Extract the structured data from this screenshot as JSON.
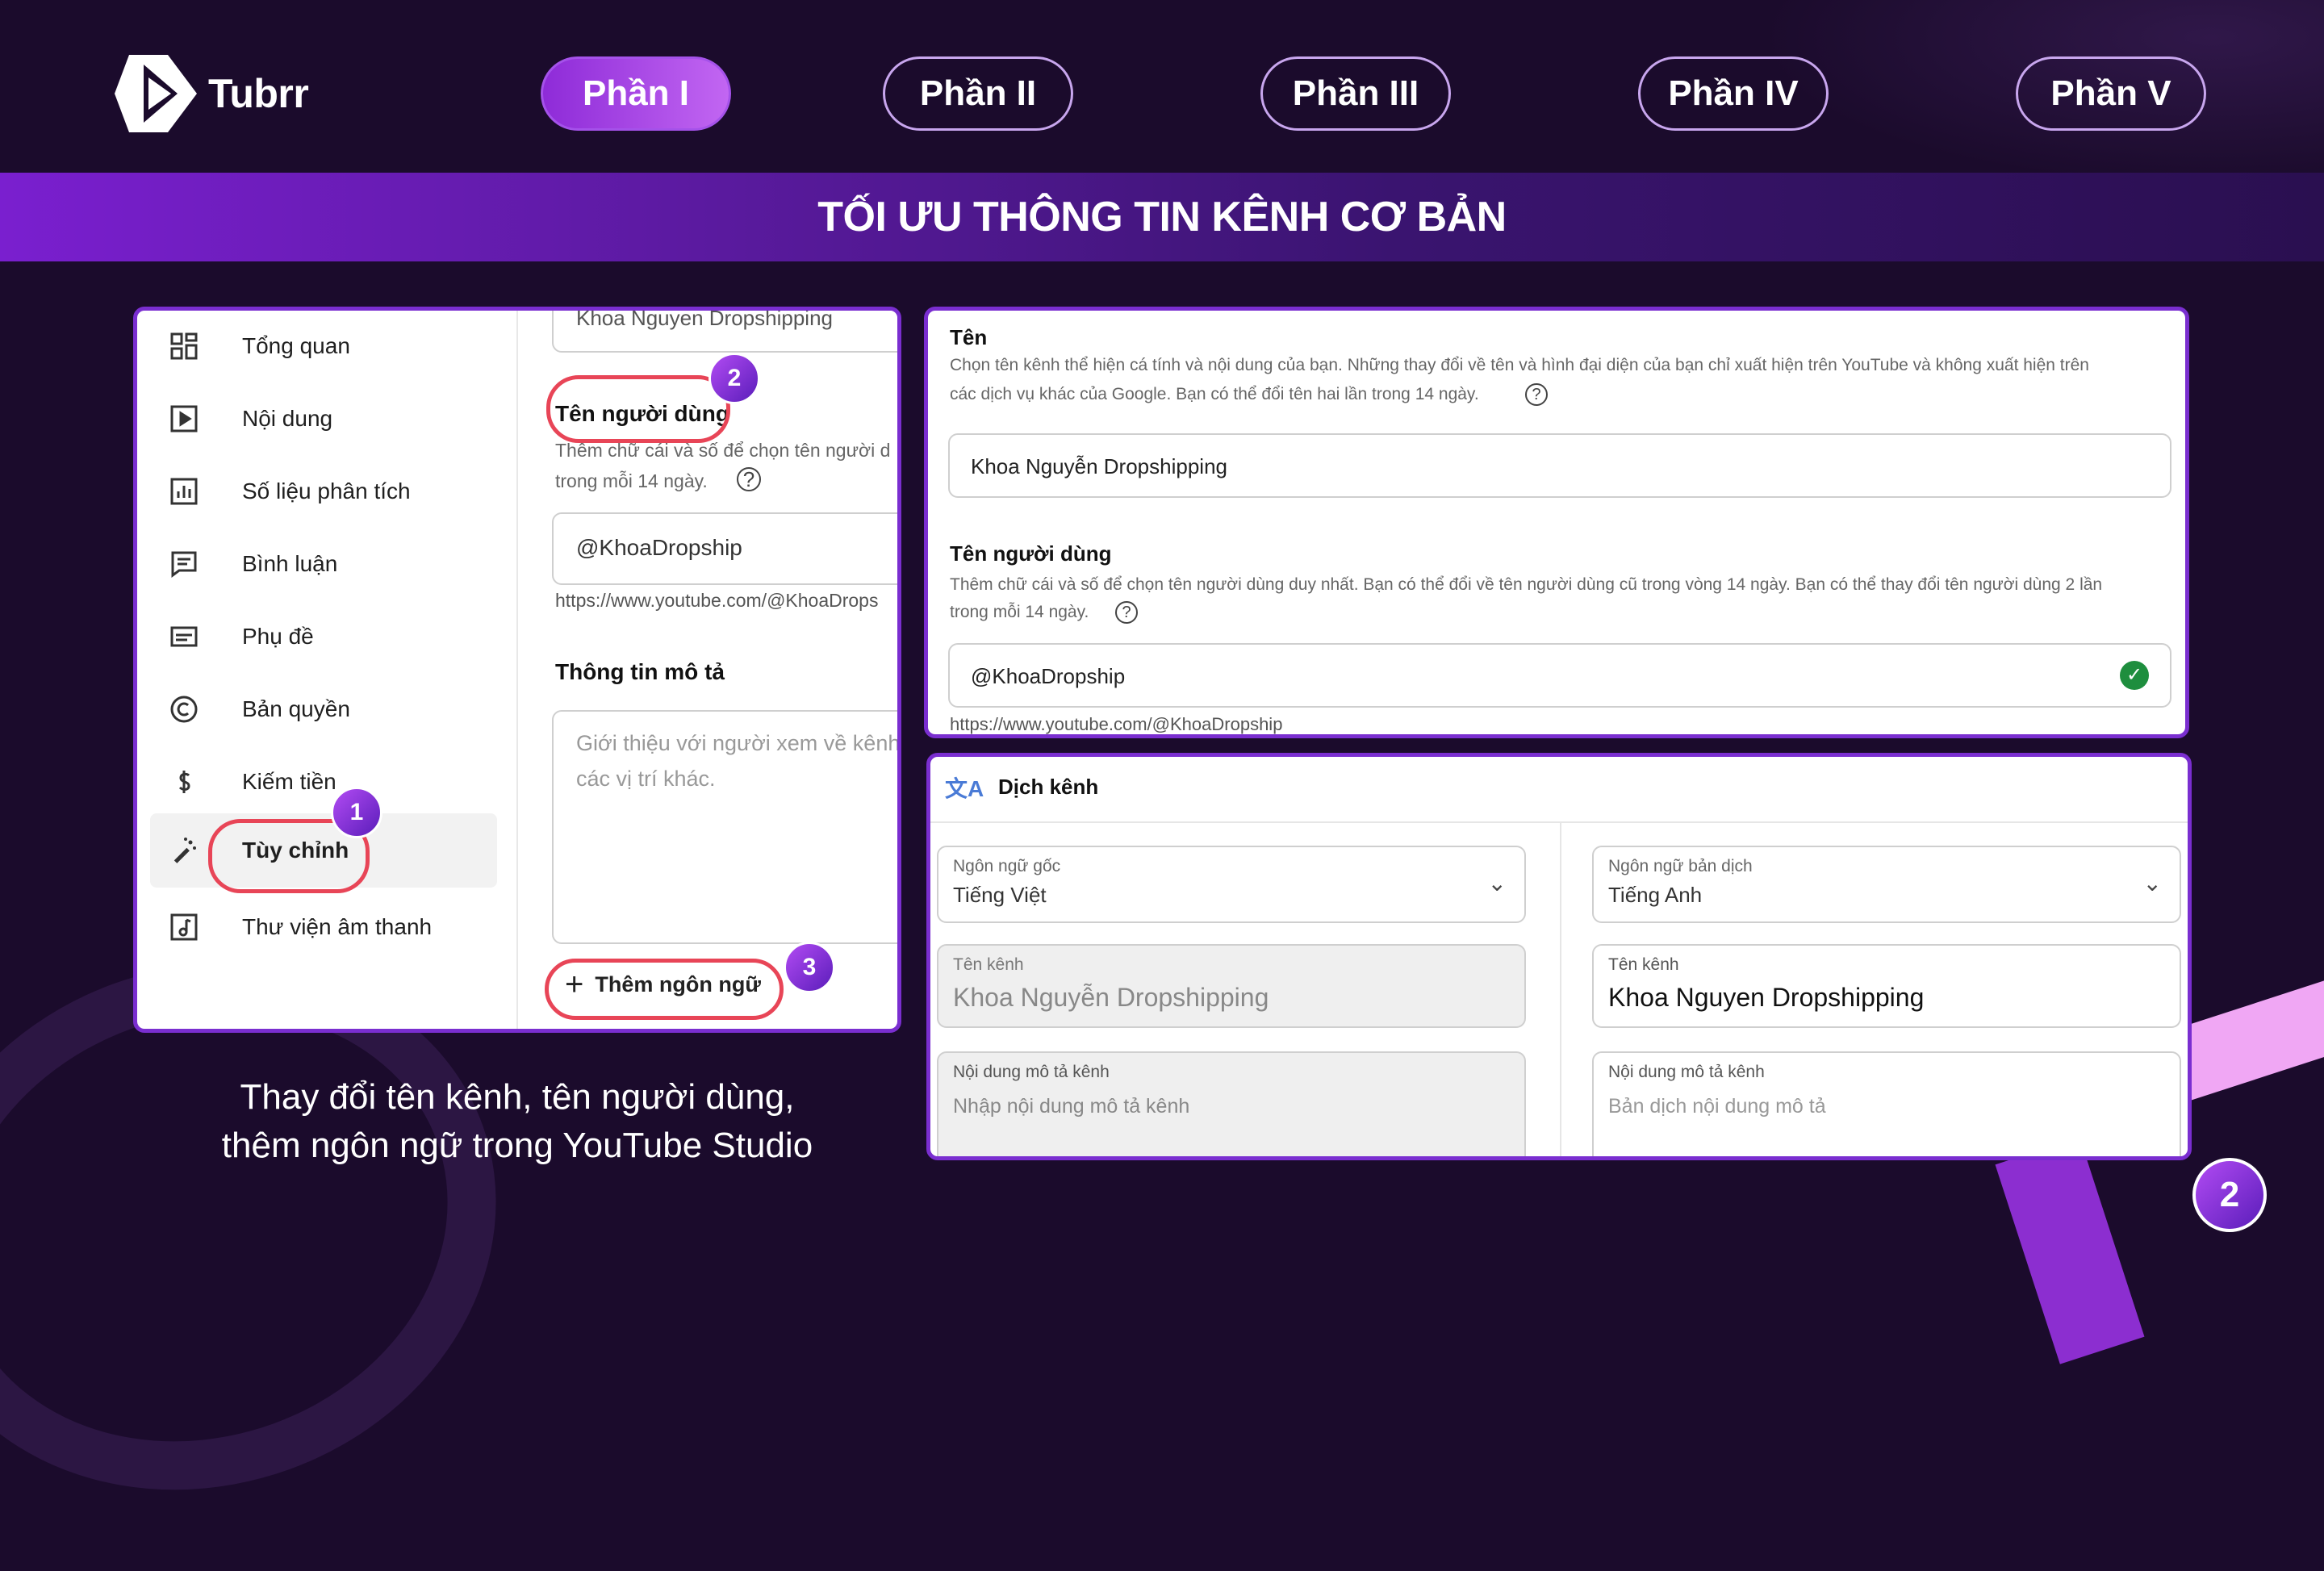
{
  "brand": {
    "name": "Tubrr"
  },
  "tabs": [
    {
      "label": "Phần I",
      "active": true
    },
    {
      "label": "Phần II",
      "active": false
    },
    {
      "label": "Phần III",
      "active": false
    },
    {
      "label": "Phần IV",
      "active": false
    },
    {
      "label": "Phần V",
      "active": false
    }
  ],
  "section_title": "TỐI ƯU THÔNG TIN KÊNH CƠ BẢN",
  "left_screenshot": {
    "nav": [
      {
        "label": "Tổng quan",
        "icon": "dashboard-icon"
      },
      {
        "label": "Nội dung",
        "icon": "content-icon"
      },
      {
        "label": "Số liệu phân tích",
        "icon": "analytics-icon"
      },
      {
        "label": "Bình luận",
        "icon": "comments-icon"
      },
      {
        "label": "Phụ đề",
        "icon": "subtitles-icon"
      },
      {
        "label": "Bản quyền",
        "icon": "copyright-icon"
      },
      {
        "label": "Kiếm tiền",
        "icon": "dollar-icon"
      },
      {
        "label": "Tùy chỉnh",
        "icon": "magic-wand-icon",
        "active": true
      },
      {
        "label": "Thư viện âm thanh",
        "icon": "audio-library-icon"
      }
    ],
    "channel_name_value": "Khoa Nguyen Dropshipping",
    "handle_label": "Tên người dùng",
    "handle_help": "Thêm chữ cái và số để chọn tên người d",
    "handle_help_2": "trong mỗi 14 ngày.",
    "handle_value": "@KhoaDropship",
    "handle_url": "https://www.youtube.com/@KhoaDrops",
    "description_label": "Thông tin mô tả",
    "description_placeholder_1": "Giới thiệu với người xem về kênh",
    "description_placeholder_2": "các vị trí khác.",
    "add_language_label": "Thêm ngôn ngữ",
    "badges": [
      "1",
      "2",
      "3"
    ]
  },
  "right_top": {
    "name_label": "Tên",
    "name_help_1": "Chọn tên kênh thể hiện cá tính và nội dung của bạn. Những thay đổi về tên và hình đại diện của bạn chỉ xuất hiện trên YouTube và không xuất hiện trên",
    "name_help_2": "các dịch vụ khác của Google. Bạn có thể đổi tên hai lần trong 14 ngày.",
    "name_value": "Khoa Nguyễn Dropshipping",
    "handle_label": "Tên người dùng",
    "handle_help_1": "Thêm chữ cái và số để chọn tên người dùng duy nhất. Bạn có thể đổi về tên người dùng cũ trong vòng 14 ngày. Bạn có thể thay đổi tên người dùng 2 lần",
    "handle_help_2": "trong mỗi 14 ngày.",
    "handle_value": "@KhoaDropship",
    "handle_url": "https://www.youtube.com/@KhoaDropship"
  },
  "right_bottom": {
    "header": "Dịch kênh",
    "source_lang_label": "Ngôn ngữ gốc",
    "source_lang_value": "Tiếng Việt",
    "target_lang_label": "Ngôn ngữ bản dịch",
    "target_lang_value": "Tiếng Anh",
    "channel_name_label": "Tên kênh",
    "source_channel_name": "Khoa Nguyễn Dropshipping",
    "target_channel_name": "Khoa Nguyen Dropshipping",
    "desc_label": "Nội dung mô tả kênh",
    "source_desc_placeholder": "Nhập nội dung mô tả kênh",
    "target_desc_placeholder": "Bản dịch nội dung mô tả"
  },
  "caption_line1": "Thay đổi tên kênh, tên người dùng,",
  "caption_line2": "thêm ngôn ngữ trong YouTube Studio",
  "page_number": "2",
  "colors": {
    "accent": "#8e2bd8",
    "annotation": "#e84557",
    "background": "#1b0b2c"
  }
}
